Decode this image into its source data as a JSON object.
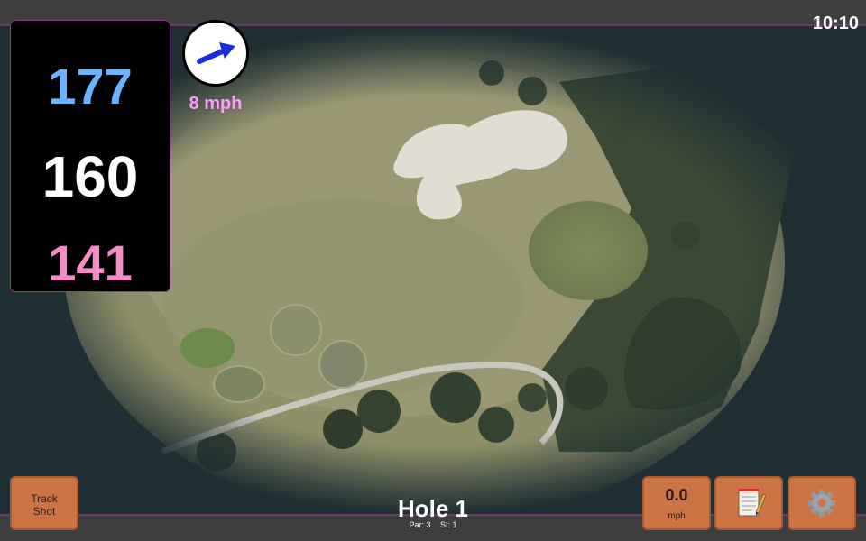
{
  "status": {
    "time": "10:10"
  },
  "distances": {
    "back": "177",
    "middle": "160",
    "front": "141"
  },
  "wind": {
    "speed": "8 mph",
    "icon": "wind-arrow-icon",
    "arrow_color": "#1a2fd8"
  },
  "buttons": {
    "track_shot": {
      "line1": "Track",
      "line2": "Shot"
    },
    "speed": {
      "value": "0.0",
      "unit": "mph"
    },
    "notes": {
      "icon": "notepad-icon"
    },
    "settings": {
      "icon": "gear-icon"
    }
  },
  "hole": {
    "title": "Hole 1",
    "par": "Par: 3",
    "si": "SI: 1"
  },
  "colors": {
    "back_distance": "#6ab4ff",
    "middle_distance": "#ffffff",
    "front_distance": "#f58cc8",
    "button": "#cd7445",
    "panel_border": "#8a3c8c",
    "bar_accent": "#6b3c6a"
  }
}
